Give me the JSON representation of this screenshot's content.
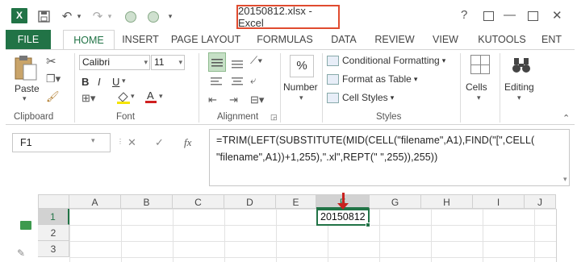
{
  "app": {
    "logo_letter": "X",
    "title": "20150812.xlsx - Excel",
    "help": "?",
    "minimize": "—",
    "accent_color": "#217346",
    "highlight_color": "#e04b2f"
  },
  "tabs": [
    "FILE",
    "HOME",
    "INSERT",
    "PAGE LAYOUT",
    "FORMULAS",
    "DATA",
    "REVIEW",
    "VIEW",
    "KUTOOLS",
    "ENT"
  ],
  "ribbon": {
    "clipboard": {
      "paste_label": "Paste",
      "group_label": "Clipboard"
    },
    "font": {
      "font_name": "Calibri",
      "font_size": "11",
      "bold": "B",
      "italic": "I",
      "underline": "U",
      "group_label": "Font"
    },
    "alignment": {
      "group_label": "Alignment"
    },
    "number": {
      "symbol": "%",
      "label": "Number"
    },
    "styles": {
      "conditional_formatting": "Conditional Formatting",
      "format_as_table": "Format as Table",
      "cell_styles": "Cell Styles",
      "group_label": "Styles"
    },
    "cells": {
      "label": "Cells"
    },
    "editing": {
      "label": "Editing"
    }
  },
  "formula_bar": {
    "name_box": "F1",
    "cancel": "✕",
    "enter": "✓",
    "fx": "fx",
    "formula_line1": "=TRIM(LEFT(SUBSTITUTE(MID(CELL(\"filename\",A1),FIND(\"[\",CELL(",
    "formula_line2": "\"filename\",A1))+1,255),\".xl\",REPT(\" \",255)),255))"
  },
  "grid": {
    "columns": [
      "A",
      "B",
      "C",
      "D",
      "E",
      "F",
      "G",
      "H",
      "I",
      "J"
    ],
    "rows": [
      "1",
      "2",
      "3"
    ],
    "active_cell_value": "20150812"
  }
}
